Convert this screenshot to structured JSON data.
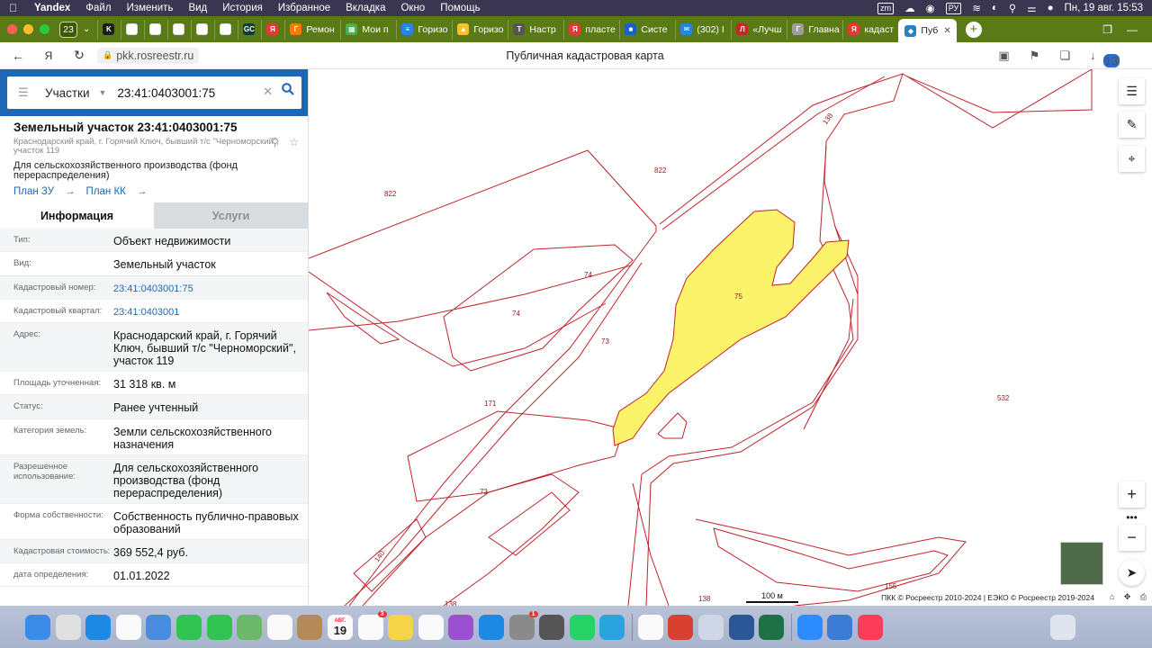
{
  "menubar": {
    "app_name": "Yandex",
    "items": [
      "Файл",
      "Изменить",
      "Вид",
      "История",
      "Избранное",
      "Вкладка",
      "Окно",
      "Помощь"
    ],
    "tray": {
      "zm": "zm",
      "lang": "РУ",
      "datetime": "Пн, 19 авг.  15:53"
    }
  },
  "tabs": {
    "count": "23",
    "items": [
      {
        "label": "",
        "color": "#1a1a1a",
        "glyph": "K"
      },
      {
        "label": "",
        "color": "#ffffff",
        "glyph": ""
      },
      {
        "label": "",
        "color": "#ffffff",
        "glyph": ""
      },
      {
        "label": "",
        "color": "#ffffff",
        "glyph": ""
      },
      {
        "label": "",
        "color": "#ffffff",
        "glyph": ""
      },
      {
        "label": "",
        "color": "#ffffff",
        "glyph": ""
      },
      {
        "label": "",
        "color": "#0b3d2e",
        "glyph": "GC"
      },
      {
        "label": "",
        "color": "#e53935",
        "glyph": "Я"
      },
      {
        "label": "Ремон",
        "color": "#f57c00",
        "glyph": "Г"
      },
      {
        "label": "Мои п",
        "color": "#4caf50",
        "glyph": "▦"
      },
      {
        "label": "Горизо",
        "color": "#1e88e5",
        "glyph": "≡"
      },
      {
        "label": "Горизо",
        "color": "#fbc02d",
        "glyph": "▲"
      },
      {
        "label": "Настр",
        "color": "#555555",
        "glyph": "T"
      },
      {
        "label": "пласте",
        "color": "#e53935",
        "glyph": "Я"
      },
      {
        "label": "Систе",
        "color": "#1565c0",
        "glyph": "■"
      },
      {
        "label": "(302) I",
        "color": "#1e88e5",
        "glyph": "✉"
      },
      {
        "label": "«Лучш",
        "color": "#c62828",
        "glyph": "Л"
      },
      {
        "label": "Главна",
        "color": "#9e9e9e",
        "glyph": "Г"
      },
      {
        "label": "кадаст",
        "color": "#e53935",
        "glyph": "Я"
      }
    ],
    "active": {
      "label": "Пуб",
      "color": "#2e7fbf",
      "glyph": "◆"
    }
  },
  "addressbar": {
    "url": "pkk.rosreestr.ru",
    "page_title": "Публичная кадастровая карта",
    "badge_count": "13"
  },
  "search": {
    "type": "Участки",
    "value": "23:41:0403001:75"
  },
  "object": {
    "title": "Земельный участок 23:41:0403001:75",
    "address_short": "Краснодарский край, г. Горячий Ключ, бывший т/с \"Черноморский\", участок 119",
    "use_short": "Для сельскохозяйственного производства (фонд перераспределения)",
    "link_plan_zu": "План ЗУ",
    "link_plan_kk": "План КК"
  },
  "info_tabs": {
    "info": "Информация",
    "services": "Услуги"
  },
  "info_rows": [
    {
      "label": "Тип:",
      "value": "Объект недвижимости"
    },
    {
      "label": "Вид:",
      "value": "Земельный участок"
    },
    {
      "label": "Кадастровый номер:",
      "value": "23:41:0403001:75",
      "link": true
    },
    {
      "label": "Кадастровый квартал:",
      "value": "23:41:0403001",
      "link": true
    },
    {
      "label": "Адрес:",
      "value": "Краснодарский край, г. Горячий Ключ, бывший т/с \"Черноморский\", участок 119"
    },
    {
      "label": "Площадь уточненная:",
      "value": "31 318 кв. м"
    },
    {
      "label": "Статус:",
      "value": "Ранее учтенный"
    },
    {
      "label": "Категория земель:",
      "value": "Земли сельскохозяйственного назначения"
    },
    {
      "label": "Разрешенное использование:",
      "value": "Для сельскохозяйственного производства (фонд перераспределения)"
    },
    {
      "label": "Форма собственности:",
      "value": "Собственность публично-правовых образований"
    },
    {
      "label": "Кадастровая стоимость:",
      "value": "369 552,4 руб."
    },
    {
      "label": "дата определения:",
      "value": "01.01.2022"
    }
  ],
  "map": {
    "parcel_labels": [
      "822",
      "822",
      "138",
      "74",
      "74",
      "73",
      "75",
      "171",
      "532",
      "73",
      "140",
      "138",
      "138",
      "155"
    ],
    "scale": "100 м",
    "copyright": "ПКК © Росреестр 2010-2024 | ЕЭКО © Росреестр 2019-2024",
    "boundary_color": "#c0232b",
    "highlight_color": "#fbf46a"
  },
  "dock": {
    "calendar_month": "АВГ.",
    "calendar_day": "19",
    "reminders_badge": "3",
    "settings_badge": "1",
    "apps": [
      "finder-icon",
      "launchpad-icon",
      "safari-icon",
      "chrome-icon",
      "mail-icon",
      "facetime-icon",
      "messages-icon",
      "maps-icon",
      "photos-icon",
      "contacts-icon",
      "calendar-icon",
      "reminders-icon",
      "notes-icon",
      "freeform-icon",
      "podcasts-icon",
      "appstore-icon",
      "settings-icon",
      "screenshot-icon",
      "whatsapp-icon",
      "telegram-icon",
      "yandex-icon",
      "office-icon",
      "preview-icon",
      "word-icon",
      "excel-icon",
      "zoom-icon",
      "wifi-icon",
      "music-icon"
    ]
  }
}
